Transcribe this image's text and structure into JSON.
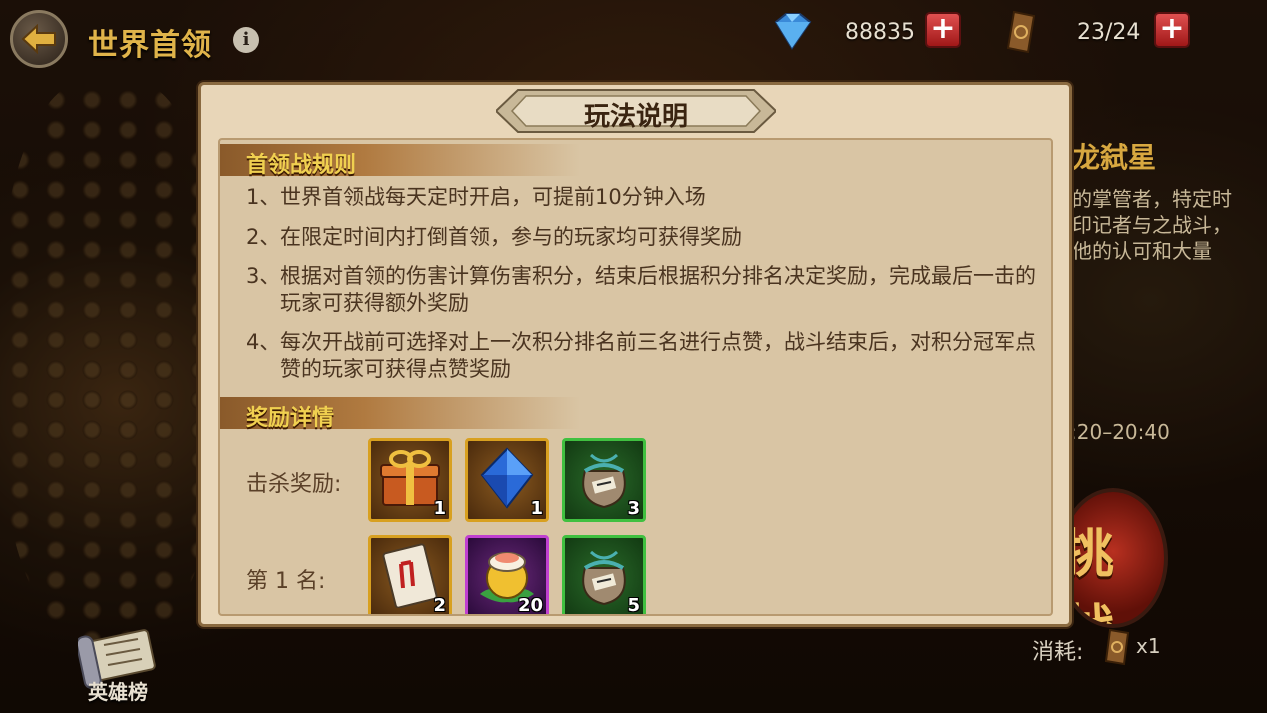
{
  "header": {
    "title": "世界首领",
    "info_icon": "i"
  },
  "resources": [
    {
      "icon": "diamond-icon",
      "value": "88835"
    },
    {
      "icon": "token-icon",
      "value": "23/24"
    }
  ],
  "side": {
    "title": "龙弑星",
    "description": "的掌管者，特定时\n印记者与之战斗，\n他的认可和大量",
    "time": ":20–20:40",
    "challenge_label": "挑战",
    "cost_label": "消耗:",
    "cost_count": "x1",
    "hero_rank_label": "英雄榜"
  },
  "dialog": {
    "title": "玩法说明",
    "rules_header": "首领战规则",
    "rules": [
      {
        "num": "1、",
        "text": "世界首领战每天定时开启，可提前10分钟入场"
      },
      {
        "num": "2、",
        "text": "在限定时间内打倒首领，参与的玩家均可获得奖励"
      },
      {
        "num": "3、",
        "text": "根据对首领的伤害计算伤害积分，结束后根据积分排名决定奖励，完成最后一击的玩家可获得额外奖励"
      },
      {
        "num": "4、",
        "text": "每次开战前可选择对上一次积分排名前三名进行点赞，战斗结束后，对积分冠军点赞的玩家可获得点赞奖励"
      }
    ],
    "rewards_header": "奖励详情",
    "reward_rows": [
      {
        "label": "击杀奖励:",
        "items": [
          {
            "icon": "gift-box-icon",
            "count": "1",
            "rarity": "gold"
          },
          {
            "icon": "diamond-icon",
            "count": "1",
            "rarity": "gold"
          },
          {
            "icon": "bag-icon",
            "count": "3",
            "rarity": "green"
          }
        ]
      },
      {
        "label": "第 1 名:",
        "items": [
          {
            "icon": "card-icon",
            "count": "2",
            "rarity": "gold"
          },
          {
            "icon": "sushi-bowl-icon",
            "count": "20",
            "rarity": "purple"
          },
          {
            "icon": "bag-icon",
            "count": "5",
            "rarity": "green"
          }
        ]
      }
    ]
  }
}
